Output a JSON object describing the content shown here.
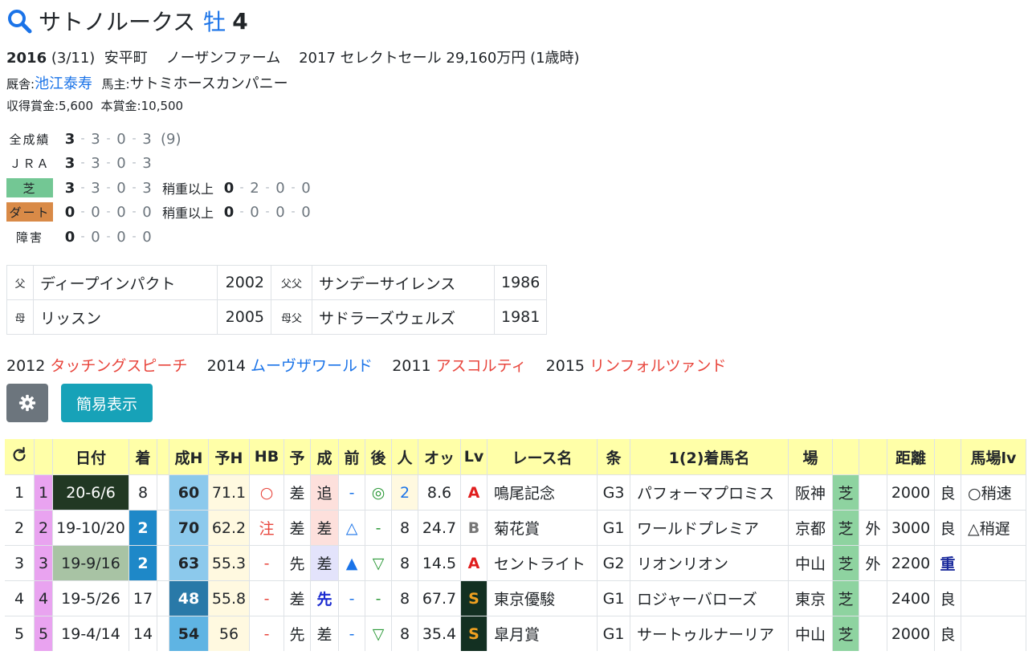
{
  "header": {
    "name": "サトノルークス",
    "sex": "牡",
    "age": "4"
  },
  "info": {
    "year": "2016",
    "birthdate": "(3/11)",
    "region": "安平町",
    "farm": "ノーザンファーム",
    "sale": "2017 セレクトセール 29,160万円 (1歳時)",
    "stable_label": "厩舎:",
    "trainer": "池江泰寿",
    "owner_label": "馬主:",
    "owner": "サトミホースカンパニー",
    "earnings": "収得賞金:5,600",
    "prize": "本賞金:10,500"
  },
  "records": {
    "all": {
      "label": "全成績",
      "r": [
        "3",
        "3",
        "0",
        "3"
      ],
      "total": "(9)"
    },
    "jra": {
      "label": "ＪＲＡ",
      "r": [
        "3",
        "3",
        "0",
        "3"
      ]
    },
    "turf": {
      "label": "芝",
      "r": [
        "3",
        "3",
        "0",
        "3"
      ],
      "heavy_label": "稍重以上",
      "h": [
        "0",
        "2",
        "0",
        "0"
      ]
    },
    "dirt": {
      "label": "ダート",
      "r": [
        "0",
        "0",
        "0",
        "0"
      ],
      "heavy_label": "稍重以上",
      "h": [
        "0",
        "0",
        "0",
        "0"
      ]
    },
    "jump": {
      "label": "障害",
      "r": [
        "0",
        "0",
        "0",
        "0"
      ]
    }
  },
  "pedigree": [
    {
      "k": "父",
      "name": "ディープインパクト",
      "year": "2002",
      "k2": "父父",
      "name2": "サンデーサイレンス",
      "year2": "1986"
    },
    {
      "k": "母",
      "name": "リッスン",
      "year": "2005",
      "k2": "母父",
      "name2": "サドラーズウェルズ",
      "year2": "1981"
    }
  ],
  "siblings": [
    {
      "year": "2012",
      "name": "タッチングスピーチ"
    },
    {
      "year": "2014",
      "name": "ムーヴザワールド"
    },
    {
      "year": "2011",
      "name": "アスコルティ"
    },
    {
      "year": "2015",
      "name": "リンフォルツァンド"
    }
  ],
  "buttons": {
    "simple_label": "簡易表示",
    "gear_icon": "gear-icon"
  },
  "table": {
    "headers": [
      "",
      "",
      "日付",
      "着",
      "",
      "成H",
      "予H",
      "HB",
      "予",
      "成",
      "前",
      "後",
      "人",
      "オッ",
      "Lv",
      "レース名",
      "条",
      "1(2)着馬名",
      "場",
      "",
      "",
      "距離",
      "",
      "馬場lv"
    ],
    "rows": [
      [
        "1",
        "1",
        "20-6/6",
        "8",
        "",
        "60",
        "71.1",
        "○",
        "差",
        "追",
        "-",
        "◎",
        "2",
        "8.6",
        "A",
        "鳴尾記念",
        "G3",
        "パフォーマプロミス",
        "阪神",
        "芝",
        "",
        "2000",
        "良",
        "○稍速"
      ],
      [
        "2",
        "2",
        "19-10/20",
        "2",
        "",
        "70",
        "62.2",
        "注",
        "差",
        "差",
        "△",
        "-",
        "8",
        "24.7",
        "B",
        "菊花賞",
        "G1",
        "ワールドプレミア",
        "京都",
        "芝",
        "外",
        "3000",
        "良",
        "△稍遅"
      ],
      [
        "3",
        "3",
        "19-9/16",
        "2",
        "",
        "63",
        "55.3",
        "-",
        "先",
        "差",
        "▲",
        "▽",
        "8",
        "14.5",
        "A",
        "セントライト",
        "G2",
        "リオンリオン",
        "中山",
        "芝",
        "外",
        "2200",
        "重",
        ""
      ],
      [
        "4",
        "4",
        "19-5/26",
        "17",
        "",
        "48",
        "55.8",
        "-",
        "差",
        "先",
        "-",
        "-",
        "8",
        "67.7",
        "S",
        "東京優駿",
        "G1",
        "ロジャーバローズ",
        "東京",
        "芝",
        "",
        "2400",
        "良",
        ""
      ],
      [
        "5",
        "5",
        "19-4/14",
        "14",
        "",
        "54",
        "56",
        "-",
        "先",
        "差",
        "-",
        "▽",
        "8",
        "35.4",
        "S",
        "皐月賞",
        "G1",
        "サートゥルナーリア",
        "中山",
        "芝",
        "",
        "2000",
        "良",
        ""
      ]
    ]
  }
}
